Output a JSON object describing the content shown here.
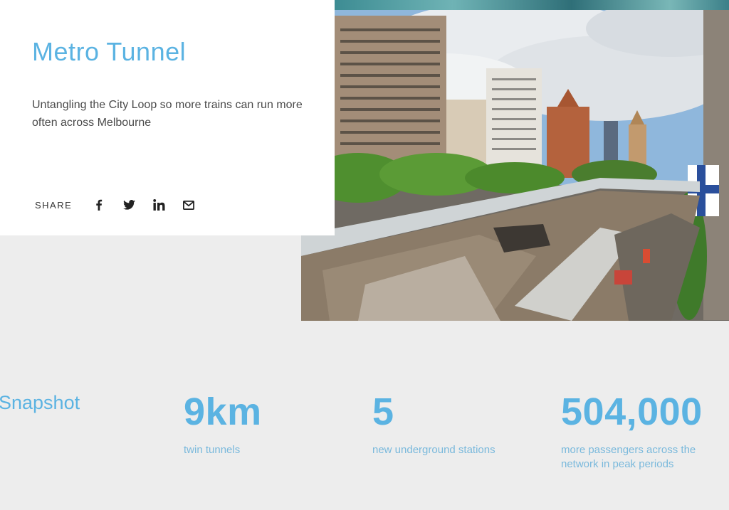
{
  "header": {
    "title": "Metro Tunnel",
    "intro": "Untangling the City Loop so more trains can run more often across Melbourne"
  },
  "share": {
    "label": "SHARE",
    "icons": [
      "facebook-icon",
      "twitter-icon",
      "linkedin-icon",
      "email-icon"
    ]
  },
  "snapshot": {
    "title": "Snapshot",
    "stats": [
      {
        "value": "9km",
        "label": "twin tunnels"
      },
      {
        "value": "5",
        "label": "new underground stations"
      },
      {
        "value": "504,000",
        "label": "more passengers across the network in peak periods"
      }
    ]
  },
  "colors": {
    "accent": "#5bb3e2",
    "background": "#ededed",
    "card": "#ffffff"
  }
}
